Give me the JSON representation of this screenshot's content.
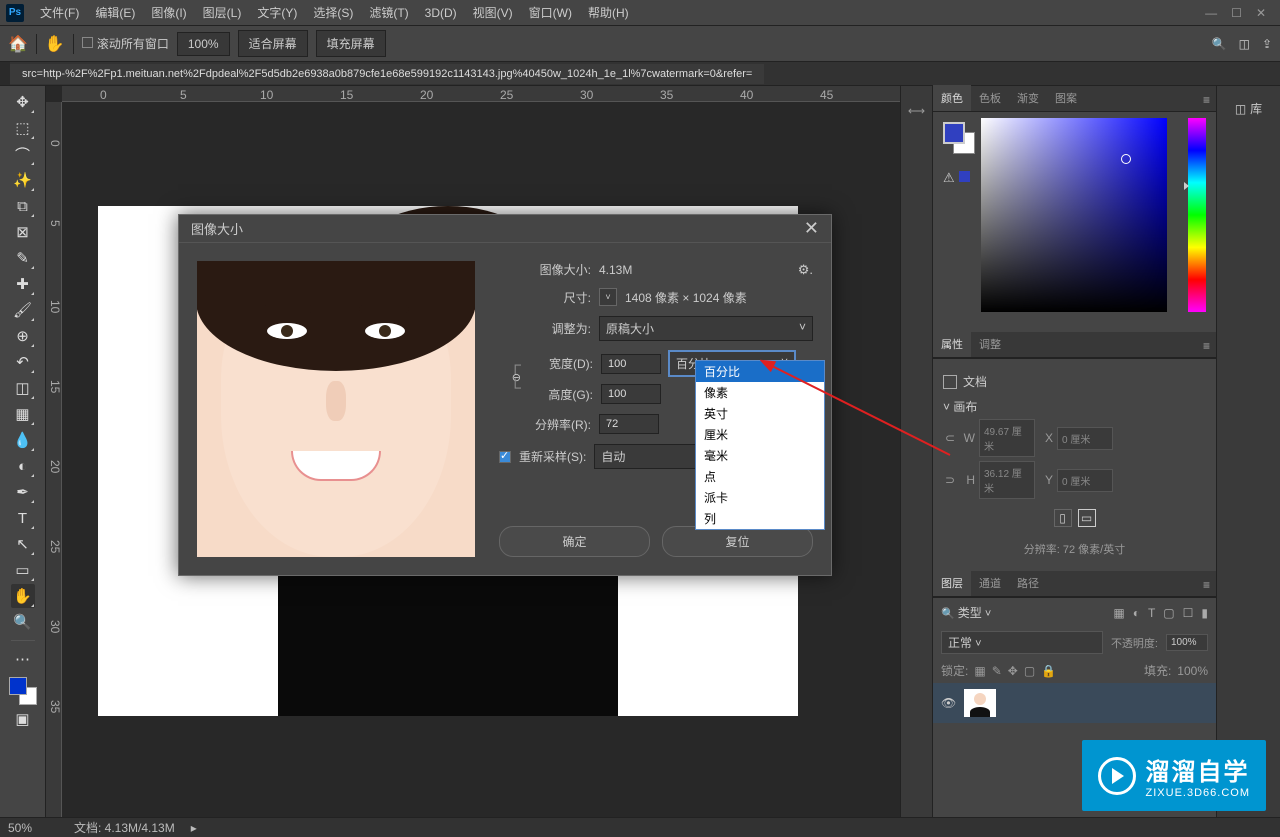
{
  "menu": {
    "items": [
      "文件(F)",
      "编辑(E)",
      "图像(I)",
      "图层(L)",
      "文字(Y)",
      "选择(S)",
      "滤镜(T)",
      "3D(D)",
      "视图(V)",
      "窗口(W)",
      "帮助(H)"
    ]
  },
  "optbar": {
    "scroll_all": "滚动所有窗口",
    "zoom": "100%",
    "fit": "适合屏幕",
    "fill": "填充屏幕"
  },
  "doctab": "src=http-%2F%2Fp1.meituan.net%2Fdpdeal%2F5d5db2e6938a0b879cfe1e68e599192c1143143.jpg%40450w_1024h_1e_1l%7cwatermark=0&refer=",
  "ruler_h": [
    "0",
    "5",
    "10",
    "15",
    "20",
    "25",
    "30",
    "35",
    "40",
    "45"
  ],
  "ruler_v": [
    "0",
    "5",
    "10",
    "15",
    "20",
    "25",
    "30",
    "35"
  ],
  "dialog": {
    "title": "图像大小",
    "size_label": "图像大小:",
    "size_value": "4.13M",
    "dim_label": "尺寸:",
    "dim_value": "1408 像素 × 1024 像素",
    "fit_label": "调整为:",
    "fit_value": "原稿大小",
    "width_label": "宽度(D):",
    "width_value": "100",
    "height_label": "高度(G):",
    "height_value": "100",
    "unit_value": "百分比",
    "res_label": "分辨率(R):",
    "res_value": "72",
    "resample_label": "重新采样(S):",
    "resample_value": "自动",
    "ok": "确定",
    "cancel": "复位"
  },
  "units_dropdown": [
    "百分比",
    "像素",
    "英寸",
    "厘米",
    "毫米",
    "点",
    "派卡",
    "列"
  ],
  "panels": {
    "color_tabs": [
      "颜色",
      "色板",
      "渐变",
      "图案"
    ],
    "lib_tab": "库",
    "props_tabs": [
      "属性",
      "调整"
    ],
    "props": {
      "doc": "文档",
      "canvas": "画布",
      "w_label": "W",
      "w_value": "49.67 厘米",
      "h_label": "H",
      "h_value": "36.12 厘米",
      "x_label": "X",
      "x_value": "0 厘米",
      "y_label": "Y",
      "y_value": "0 厘米",
      "res": "分辨率: 72 像素/英寸"
    },
    "layers_tabs": [
      "图层",
      "通道",
      "路径"
    ],
    "layers": {
      "filter": "类型",
      "blend": "正常",
      "opacity_label": "不透明度:",
      "opacity_value": "100%",
      "lock_label": "锁定:",
      "fill_label": "填充:",
      "fill_value": "100%"
    }
  },
  "watermark": {
    "big": "溜溜自学",
    "small": "ZIXUE.3D66.COM"
  },
  "status": {
    "zoom": "50%",
    "doc": "文档: 4.13M/4.13M"
  }
}
